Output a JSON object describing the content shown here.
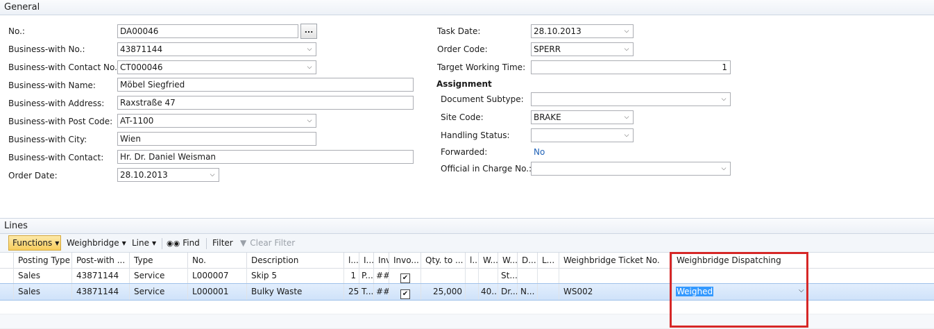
{
  "general": {
    "title": "General",
    "no": {
      "label": "No.:",
      "value": "DA00046",
      "lookup": "..."
    },
    "business_with_no": {
      "label": "Business-with No.:",
      "value": "43871144"
    },
    "business_with_contact_no": {
      "label": "Business-with Contact No.:",
      "value": "CT000046"
    },
    "business_with_name": {
      "label": "Business-with Name:",
      "value": "Möbel Siegfried"
    },
    "business_with_address": {
      "label": "Business-with Address:",
      "value": "Raxstraße 47"
    },
    "business_with_post_code": {
      "label": "Business-with Post Code:",
      "value": "AT-1100"
    },
    "business_with_city": {
      "label": "Business-with City:",
      "value": "Wien"
    },
    "business_with_contact": {
      "label": "Business-with Contact:",
      "value": "Hr. Dr. Daniel Weisman"
    },
    "order_date": {
      "label": "Order Date:",
      "value": "28.10.2013"
    },
    "task_date": {
      "label": "Task Date:",
      "value": "28.10.2013"
    },
    "order_code": {
      "label": "Order Code:",
      "value": "SPERR"
    },
    "target_working_time": {
      "label": "Target Working Time:",
      "value": "1"
    },
    "assignment_heading": "Assignment",
    "document_subtype": {
      "label": "Document Subtype:",
      "value": ""
    },
    "site_code": {
      "label": "Site Code:",
      "value": "BRAKE"
    },
    "handling_status": {
      "label": "Handling Status:",
      "value": ""
    },
    "forwarded": {
      "label": "Forwarded:",
      "value": "No"
    },
    "official_in_charge": {
      "label": "Official in Charge No.:",
      "value": ""
    }
  },
  "lines": {
    "title": "Lines",
    "toolbar": {
      "functions": "Functions",
      "weighbridge": "Weighbridge",
      "line": "Line",
      "find": "Find",
      "filter": "Filter",
      "clear_filter": "Clear Filter"
    },
    "columns": [
      "Posting Type",
      "Post-with ...",
      "Type",
      "No.",
      "Description",
      "l...",
      "I...",
      "Invo...",
      "Qty. to ...",
      "l...",
      "W...",
      "W...",
      "D...",
      "L...",
      "Weighbridge Ticket No.",
      "Weighbridge Dispatching"
    ],
    "rows": [
      {
        "posting_type": "Sales",
        "post_with": "43871144",
        "type": "Service",
        "no": "L000007",
        "description": "Skip 5",
        "c6": "1",
        "c7": "P...",
        "c8": "##",
        "invoice": "✔",
        "qty": "",
        "c11": "",
        "c12": "",
        "c13": "St...",
        "c14": "",
        "c15": "",
        "ticket": "",
        "dispatching": ""
      },
      {
        "posting_type": "Sales",
        "post_with": "43871144",
        "type": "Service",
        "no": "L000001",
        "description": "Bulky Waste",
        "c6": "25",
        "c7": "T...",
        "c8": "##",
        "invoice": "✔",
        "qty": "25,000",
        "c11": "",
        "c12": "40...",
        "c13": "Dr...",
        "c14": "N...",
        "c15": "",
        "ticket": "WS002",
        "dispatching": "Weighed"
      }
    ]
  }
}
